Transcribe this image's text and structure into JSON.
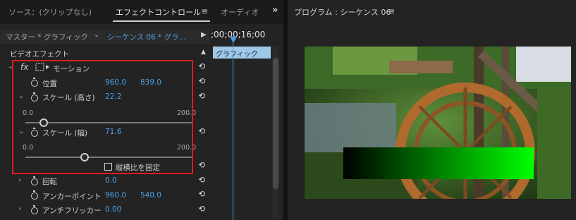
{
  "tabs": {
    "source": "ソース：(クリップなし)",
    "effect_controls": "エフェクトコントロール",
    "audio": "オーディオ",
    "overflow": "»"
  },
  "effect_controls": {
    "master_label": "マスター * グラフィック",
    "sequence_label": "シーケンス 06 * グラ...",
    "timecode": ";00;00;16;00",
    "clip_name": "グラフィック",
    "section_title": "ビデオエフェクト",
    "motion": {
      "label": "モーション",
      "position": {
        "label": "位置",
        "x": "960.0",
        "y": "839.0"
      },
      "scale_height": {
        "label": "スケール (高さ)",
        "value": "22.2",
        "min": "0.0",
        "max": "200.0",
        "level": 0.111
      },
      "scale_width": {
        "label": "スケール (幅)",
        "value": "71.6",
        "min": "0.0",
        "max": "200.0",
        "level": 0.358
      },
      "uniform_scale_label": "縦横比を固定",
      "uniform_scale_checked": false
    },
    "rotation": {
      "label": "回転",
      "value": "0.0"
    },
    "anchor_point": {
      "label": "アンカーポイント",
      "x": "960.0",
      "y": "540.0"
    },
    "anti_flicker": {
      "label": "アンチフリッカー",
      "value": "0.00"
    }
  },
  "program_monitor": {
    "title": "プログラム : シーケンス 06"
  },
  "icons": {
    "fx": "fx-icon",
    "transform": "transform-box-icon",
    "stopwatch": "stopwatch-icon",
    "reset": "reset-icon",
    "menu": "hamburger-icon"
  },
  "colors": {
    "accent_blue": "#4aa0e8",
    "highlight_red": "#e11c1c",
    "gradient_start": "#000000",
    "gradient_end": "#00ff00"
  }
}
